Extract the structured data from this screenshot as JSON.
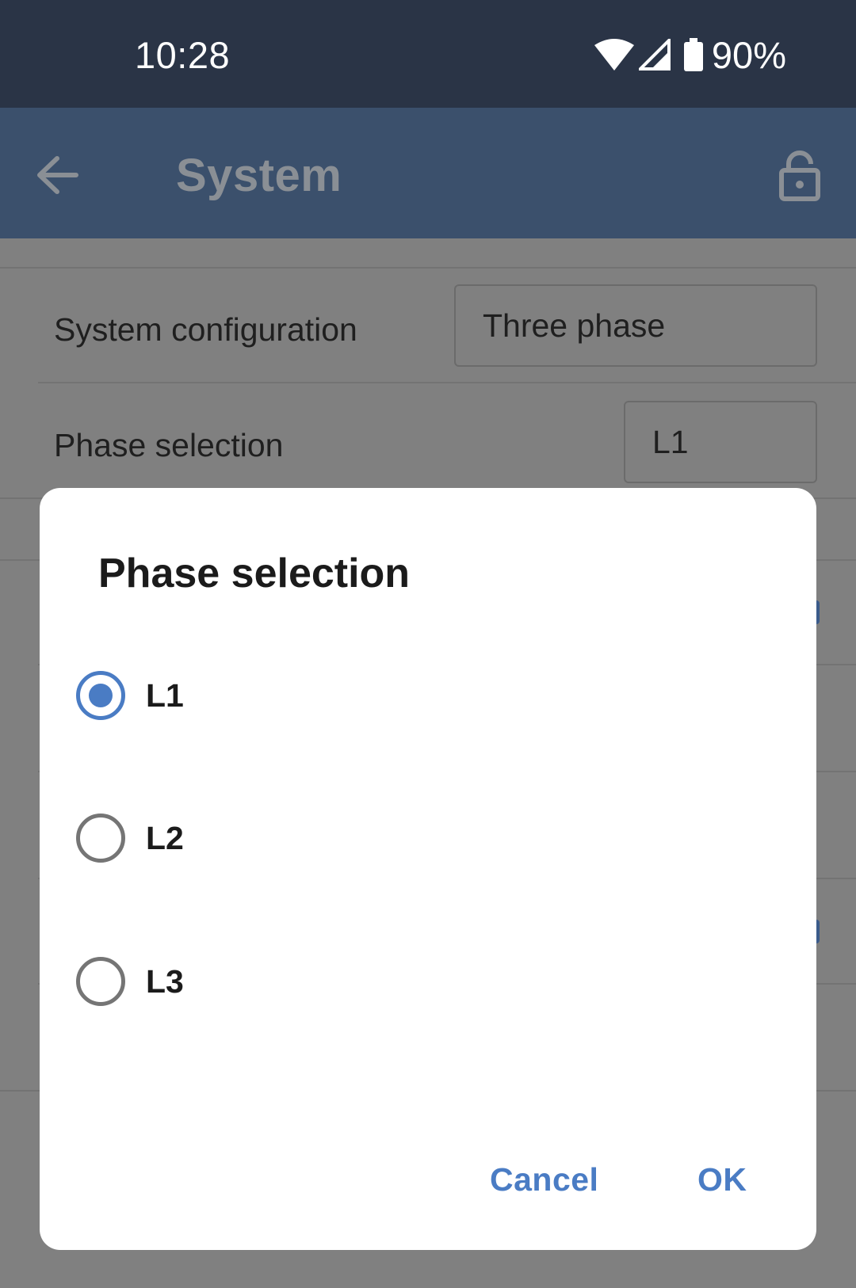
{
  "status_bar": {
    "time": "10:28",
    "battery_percent": "90%"
  },
  "app_bar": {
    "title": "System",
    "back_icon": "arrow-left-icon",
    "lock_icon": "lock-icon"
  },
  "settings": {
    "system_configuration": {
      "label": "System configuration",
      "value": "Three phase"
    },
    "phase_selection": {
      "label": "Phase selection",
      "value": "L1"
    }
  },
  "dialog": {
    "title": "Phase selection",
    "options": [
      {
        "label": "L1",
        "selected": true
      },
      {
        "label": "L2",
        "selected": false
      },
      {
        "label": "L3",
        "selected": false
      }
    ],
    "cancel_label": "Cancel",
    "ok_label": "OK"
  },
  "colors": {
    "accent": "#4a7cc4",
    "app_bar": "#3b506c",
    "status_bar": "#2a3446"
  }
}
